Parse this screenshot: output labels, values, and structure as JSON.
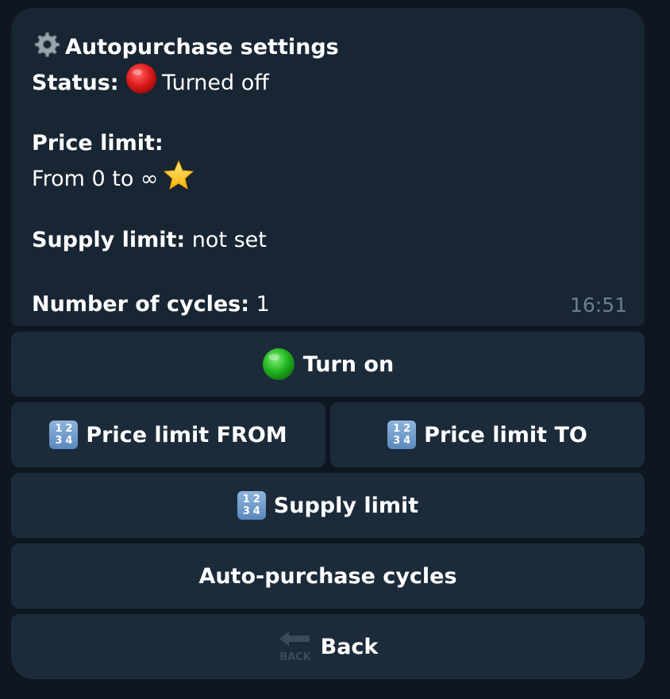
{
  "message": {
    "title": "Autopurchase settings",
    "title_icon": "gear-icon",
    "status_label": "Status:",
    "status_icon": "red-circle-icon",
    "status_value": "Turned off",
    "price_limit_label": "Price limit:",
    "price_limit_value": "From 0 to ∞",
    "price_limit_icon": "star-icon",
    "supply_limit_label": "Supply limit:",
    "supply_limit_value": "not set",
    "cycles_label": "Number of cycles:",
    "cycles_value": "1",
    "time": "16:51"
  },
  "buttons": {
    "turn_on": {
      "label": "Turn on",
      "icon": "green-circle-icon"
    },
    "price_from": {
      "label": "Price limit FROM",
      "icon": "numbers-icon"
    },
    "price_to": {
      "label": "Price limit TO",
      "icon": "numbers-icon"
    },
    "supply": {
      "label": "Supply limit",
      "icon": "numbers-icon"
    },
    "cycles": {
      "label": "Auto-purchase cycles"
    },
    "back": {
      "label": "Back",
      "icon": "back-arrow-icon",
      "icon_text": "BACK"
    }
  },
  "numpad_digits": [
    "1",
    "2",
    "3",
    "4"
  ],
  "colors": {
    "background": "#0e1621",
    "bubble": "#182533",
    "button": "#1c2b3a",
    "time": "#6d7f8f"
  }
}
